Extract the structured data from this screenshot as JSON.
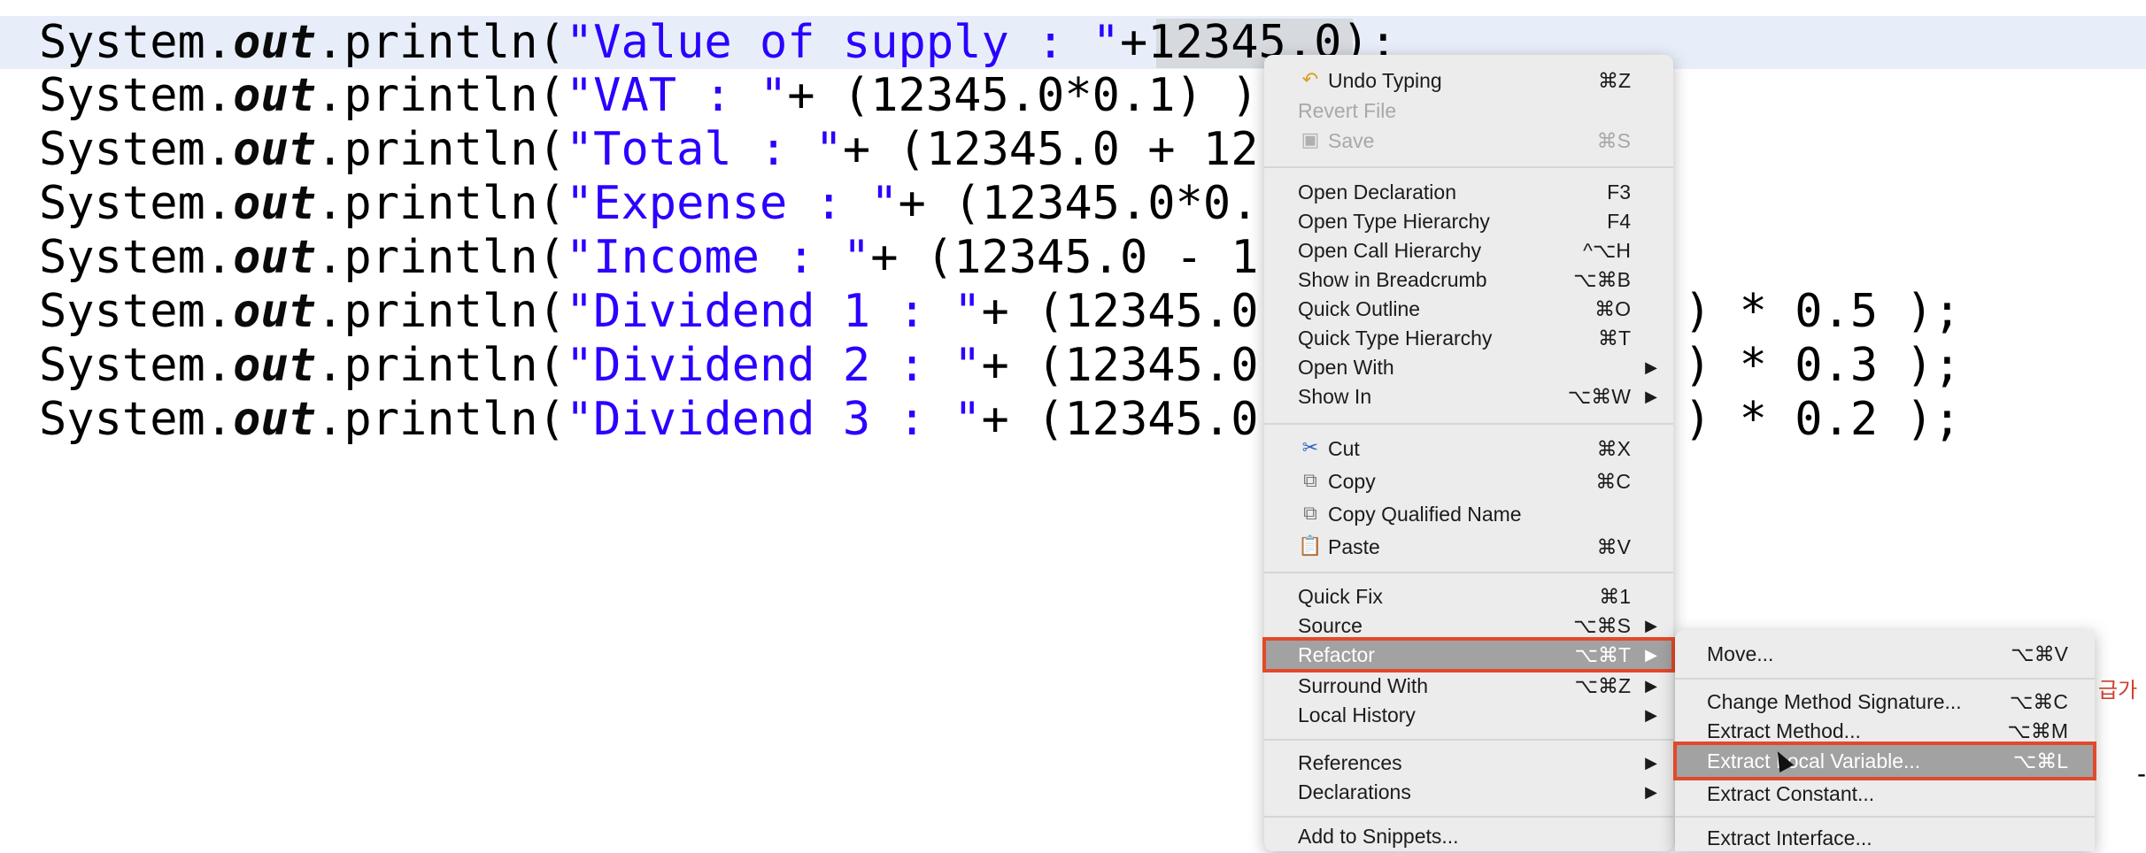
{
  "editor": {
    "lines": [
      {
        "prefix": "System.",
        "kw": "out",
        "mid": ".println(",
        "str": "\"Value of supply : \"",
        "rest": "+12345.0);"
      },
      {
        "prefix": "System.",
        "kw": "out",
        "mid": ".println(",
        "str": "\"VAT : \"",
        "rest": "+ (12345.0*0.1) )"
      },
      {
        "prefix": "System.",
        "kw": "out",
        "mid": ".println(",
        "str": "\"Total : \"",
        "rest": "+ (12345.0 + 12"
      },
      {
        "prefix": "System.",
        "kw": "out",
        "mid": ".println(",
        "str": "\"Expense : \"",
        "rest": "+ (12345.0*0."
      },
      {
        "prefix": "System.",
        "kw": "out",
        "mid": ".println(",
        "str": "\"Income : \"",
        "rest": "+ (12345.0 - 1"
      },
      {
        "prefix": "System.",
        "kw": "out",
        "mid": ".println(",
        "str": "\"Dividend 1 : \"",
        "rest": "+ (12345.0"
      },
      {
        "prefix": "System.",
        "kw": "out",
        "mid": ".println(",
        "str": "\"Dividend 2 : \"",
        "rest": "+ (12345.0"
      },
      {
        "prefix": "System.",
        "kw": "out",
        "mid": ".println(",
        "str": "\"Dividend 3 : \"",
        "rest": "+ (12345.0"
      }
    ],
    "tails": [
      ") * 0.5 );",
      ") * 0.3 );",
      ") * 0.2 );"
    ],
    "side_text": "급가",
    "edge_mark": "-"
  },
  "context_menu": {
    "items": [
      {
        "label": "Undo Typing",
        "shortcut": "⌘Z",
        "icon": "undo-icon"
      },
      {
        "label": "Revert File",
        "shortcut": "",
        "disabled": true
      },
      {
        "label": "Save",
        "shortcut": "⌘S",
        "icon": "save-icon",
        "disabled": true
      },
      {
        "label": "Open Declaration",
        "shortcut": "F3"
      },
      {
        "label": "Open Type Hierarchy",
        "shortcut": "F4"
      },
      {
        "label": "Open Call Hierarchy",
        "shortcut": "^⌥H"
      },
      {
        "label": "Show in Breadcrumb",
        "shortcut": "⌥⌘B"
      },
      {
        "label": "Quick Outline",
        "shortcut": "⌘O"
      },
      {
        "label": "Quick Type Hierarchy",
        "shortcut": "⌘T"
      },
      {
        "label": "Open With",
        "shortcut": "",
        "submenu": true
      },
      {
        "label": "Show In",
        "shortcut": "⌥⌘W",
        "submenu": true
      },
      {
        "label": "Cut",
        "shortcut": "⌘X",
        "icon": "scissors-icon"
      },
      {
        "label": "Copy",
        "shortcut": "⌘C",
        "icon": "copy-icon"
      },
      {
        "label": "Copy Qualified Name",
        "shortcut": "",
        "icon": "copy-qualified-icon"
      },
      {
        "label": "Paste",
        "shortcut": "⌘V",
        "icon": "paste-icon"
      },
      {
        "label": "Quick Fix",
        "shortcut": "⌘1"
      },
      {
        "label": "Source",
        "shortcut": "⌥⌘S",
        "submenu": true
      },
      {
        "label": "Refactor",
        "shortcut": "⌥⌘T",
        "submenu": true,
        "active": true
      },
      {
        "label": "Surround With",
        "shortcut": "⌥⌘Z",
        "submenu": true
      },
      {
        "label": "Local History",
        "shortcut": "",
        "submenu": true
      },
      {
        "label": "References",
        "shortcut": "",
        "submenu": true
      },
      {
        "label": "Declarations",
        "shortcut": "",
        "submenu": true
      },
      {
        "label": "Add to Snippets...",
        "shortcut": ""
      }
    ],
    "submenu_arrow": "▶"
  },
  "refactor_submenu": {
    "items": [
      {
        "label": "Move...",
        "shortcut": "⌥⌘V"
      },
      {
        "label": "Change Method Signature...",
        "shortcut": "⌥⌘C"
      },
      {
        "label": "Extract Method...",
        "shortcut": "⌥⌘M"
      },
      {
        "label": "Extract Local Variable...",
        "shortcut": "⌥⌘L",
        "active": true
      },
      {
        "label": "Extract Constant...",
        "shortcut": ""
      },
      {
        "label": "Extract Interface...",
        "shortcut": ""
      }
    ]
  }
}
